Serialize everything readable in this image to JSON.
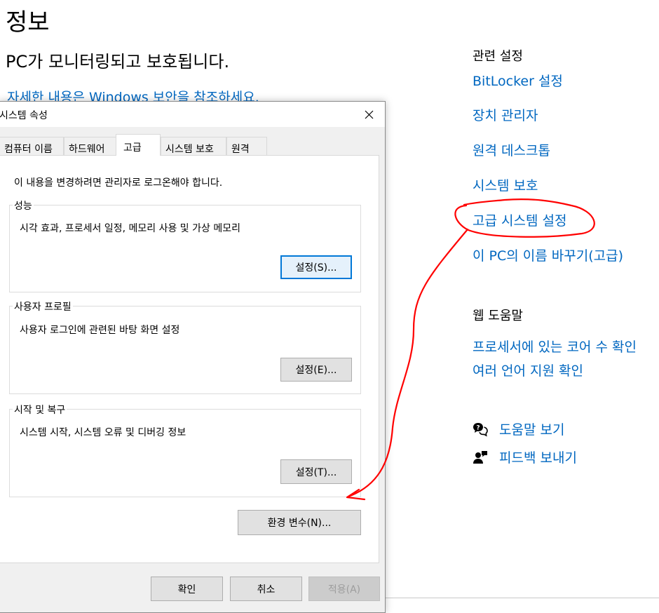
{
  "settings_page": {
    "title": "정보",
    "subtitle": "PC가 모니터링되고 보호됩니다.",
    "security_link": "자세한 내용은 Windows 보안을 참조하세요."
  },
  "related_settings": {
    "heading": "관련 설정",
    "links": [
      "BitLocker 설정",
      "장치 관리자",
      "원격 데스크톱",
      "시스템 보호",
      "고급 시스템 설정",
      "이 PC의 이름 바꾸기(고급)"
    ]
  },
  "web_help": {
    "heading": "웹 도움말",
    "links": [
      "프로세서에 있는 코어 수 확인",
      "여러 언어 지원 확인"
    ]
  },
  "help_actions": {
    "get_help": "도움말 보기",
    "give_feedback": "피드백 보내기"
  },
  "dialog": {
    "title": "시스템 속성",
    "tabs": [
      "컴퓨터 이름",
      "하드웨어",
      "고급",
      "시스템 보호",
      "원격"
    ],
    "active_tab": "고급",
    "notice": "이 내용을 변경하려면 관리자로 로그온해야 합니다.",
    "groups": {
      "performance": {
        "label": "성능",
        "description": "시각 효과, 프로세서 일정, 메모리 사용 및 가상 메모리",
        "button": "설정(S)..."
      },
      "user_profiles": {
        "label": "사용자 프로필",
        "description": "사용자 로그인에 관련된 바탕 화면 설정",
        "button": "설정(E)..."
      },
      "startup_recovery": {
        "label": "시작 및 복구",
        "description": "시스템 시작, 시스템 오류 및 디버깅 정보",
        "button": "설정(T)..."
      }
    },
    "env_button": "환경 변수(N)...",
    "ok_button": "확인",
    "cancel_button": "취소",
    "apply_button": "적용(A)"
  },
  "colors": {
    "link": "#0067c0",
    "annotation": "#ff0000",
    "focus_border": "#0078d7"
  }
}
